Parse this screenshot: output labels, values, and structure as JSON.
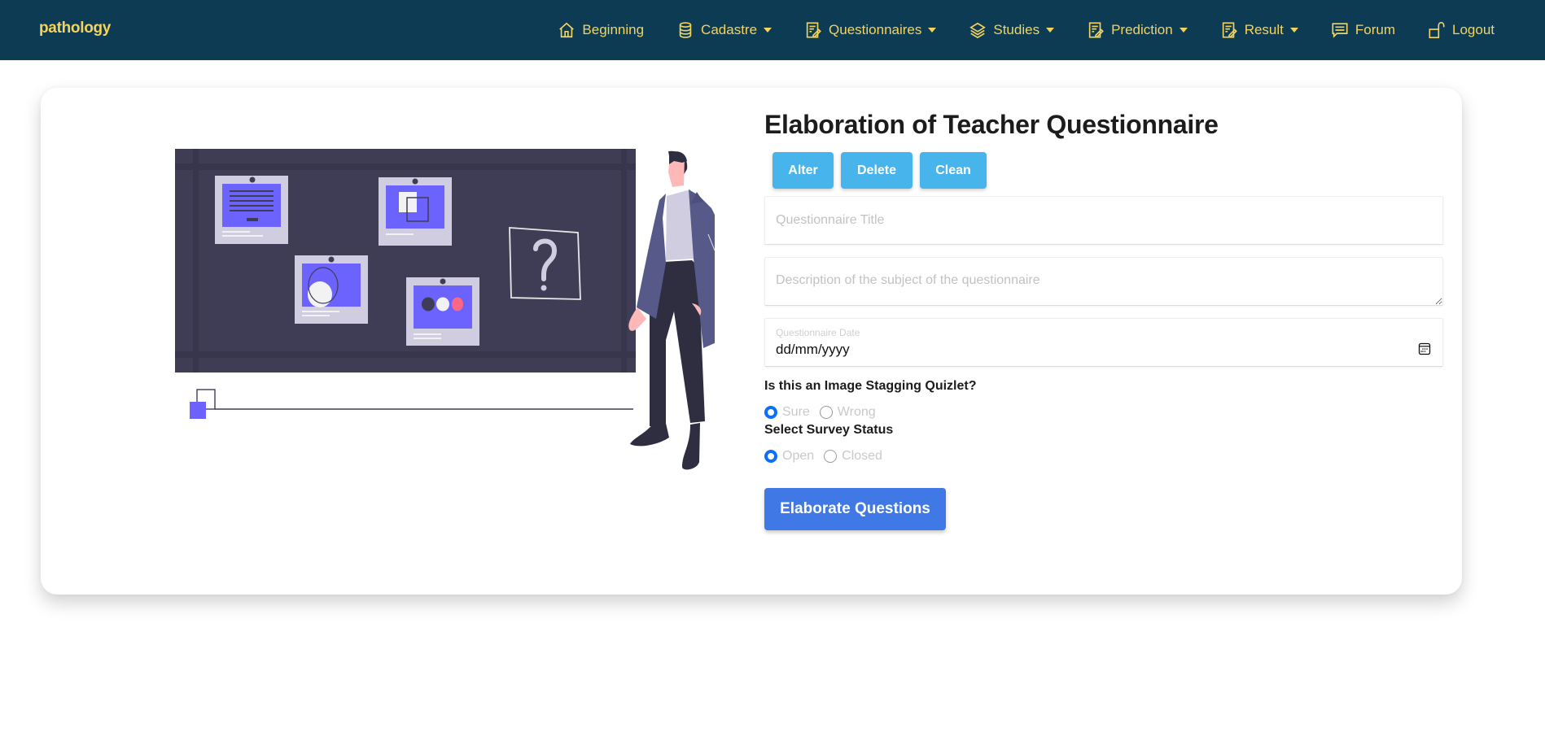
{
  "brand": "pathology",
  "nav": {
    "items": [
      {
        "label": "Beginning",
        "icon": "home-icon",
        "dropdown": false
      },
      {
        "label": "Cadastre",
        "icon": "database-icon",
        "dropdown": true
      },
      {
        "label": "Questionnaires",
        "icon": "edit-document-icon",
        "dropdown": true
      },
      {
        "label": "Studies",
        "icon": "layers-icon",
        "dropdown": true
      },
      {
        "label": "Prediction",
        "icon": "edit-document-icon",
        "dropdown": true
      },
      {
        "label": "Result",
        "icon": "edit-document-icon",
        "dropdown": true
      },
      {
        "label": "Forum",
        "icon": "chat-icon",
        "dropdown": false
      },
      {
        "label": "Logout",
        "icon": "unlock-icon",
        "dropdown": false
      }
    ]
  },
  "colors": {
    "navbar_bg": "#0d3b53",
    "nav_text": "#f4d35e",
    "action_button": "#48b4ec",
    "primary_button": "#4079e6",
    "radio_accent": "#0d6efd",
    "illustration_accent": "#6c63ff"
  },
  "form": {
    "title": "Elaboration of Teacher Questionnaire",
    "actions": {
      "alter": "Alter",
      "delete": "Delete",
      "clean": "Clean"
    },
    "title_field": {
      "placeholder": "Questionnaire Title",
      "value": ""
    },
    "description_field": {
      "placeholder": "Description of the subject of the questionnaire",
      "value": ""
    },
    "date_field": {
      "label": "Questionnaire Date",
      "value": "dd/mm/yyyy"
    },
    "image_staging": {
      "question": "Is this an Image Stagging Quizlet?",
      "options": [
        {
          "label": "Sure",
          "selected": true
        },
        {
          "label": "Wrong",
          "selected": false
        }
      ]
    },
    "survey_status": {
      "question": "Select Survey Status",
      "options": [
        {
          "label": "Open",
          "selected": true
        },
        {
          "label": "Closed",
          "selected": false
        }
      ]
    },
    "submit_label": "Elaborate Questions"
  }
}
